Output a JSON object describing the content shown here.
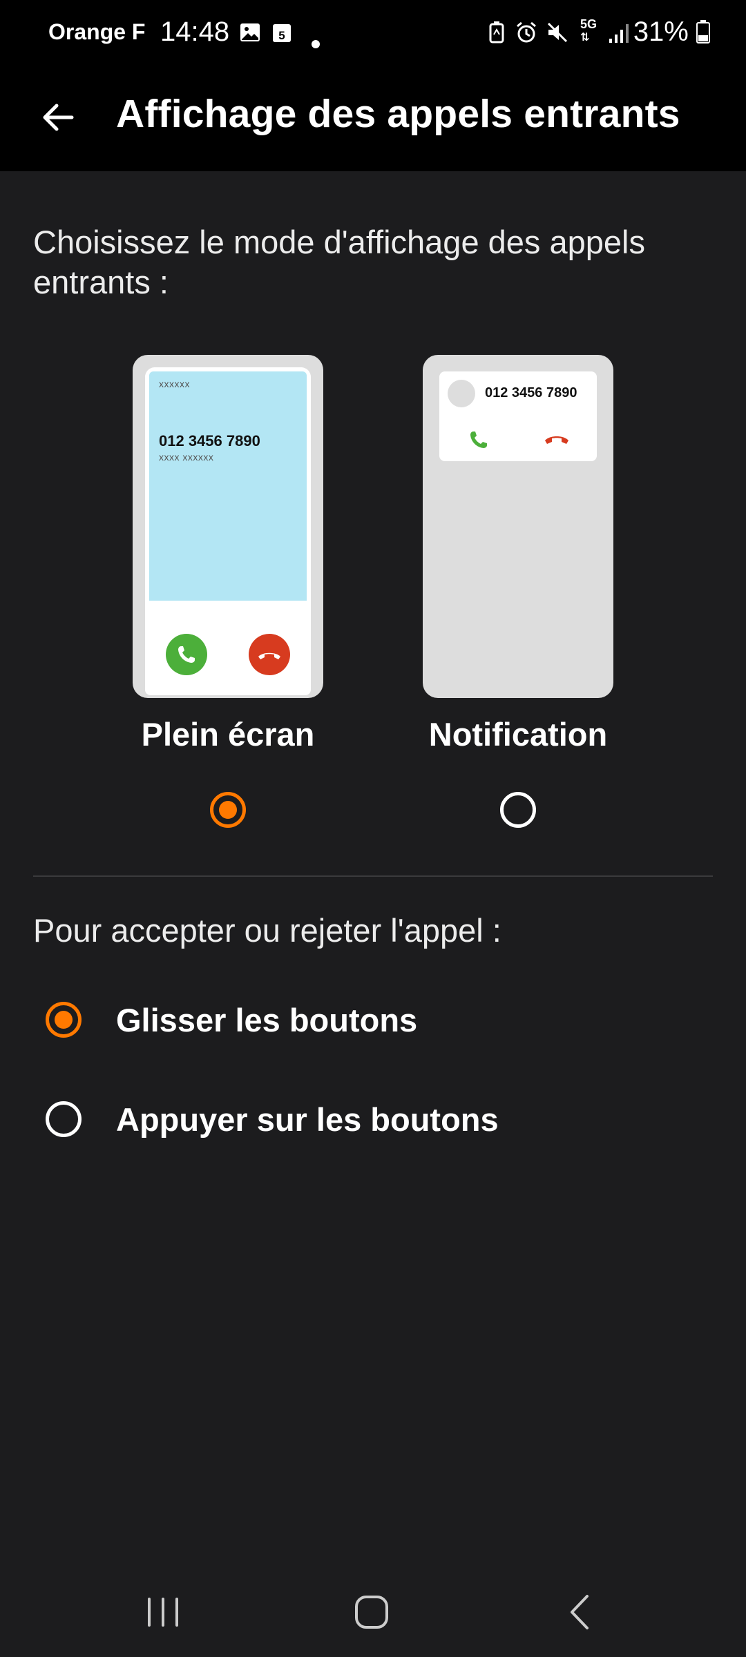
{
  "status": {
    "carrier": "Orange F",
    "time": "14:48",
    "calendar_day": "5",
    "network": "5G",
    "battery": "31%"
  },
  "appbar": {
    "title": "Affichage des appels entrants"
  },
  "display": {
    "prompt": "Choisissez le mode d'affichage des appels entrants :",
    "options": [
      {
        "label": "Plein écran",
        "selected": true,
        "mock": {
          "name": "xxxxxx",
          "number": "012 3456 7890",
          "subtext": "xxxx xxxxxx"
        }
      },
      {
        "label": "Notification",
        "selected": false,
        "mock": {
          "number": "012 3456 7890"
        }
      }
    ]
  },
  "answer": {
    "prompt": "Pour accepter ou rejeter l'appel :",
    "options": [
      {
        "label": "Glisser les boutons",
        "selected": true
      },
      {
        "label": "Appuyer sur les boutons",
        "selected": false
      }
    ]
  },
  "colors": {
    "accent": "#ff7900",
    "accept": "#4caf3a",
    "reject": "#d73b1f",
    "background": "#1c1c1e"
  },
  "icons": [
    "back-arrow-icon",
    "phone-accept-icon",
    "phone-reject-icon",
    "recent-apps-icon",
    "home-icon",
    "nav-back-icon"
  ]
}
